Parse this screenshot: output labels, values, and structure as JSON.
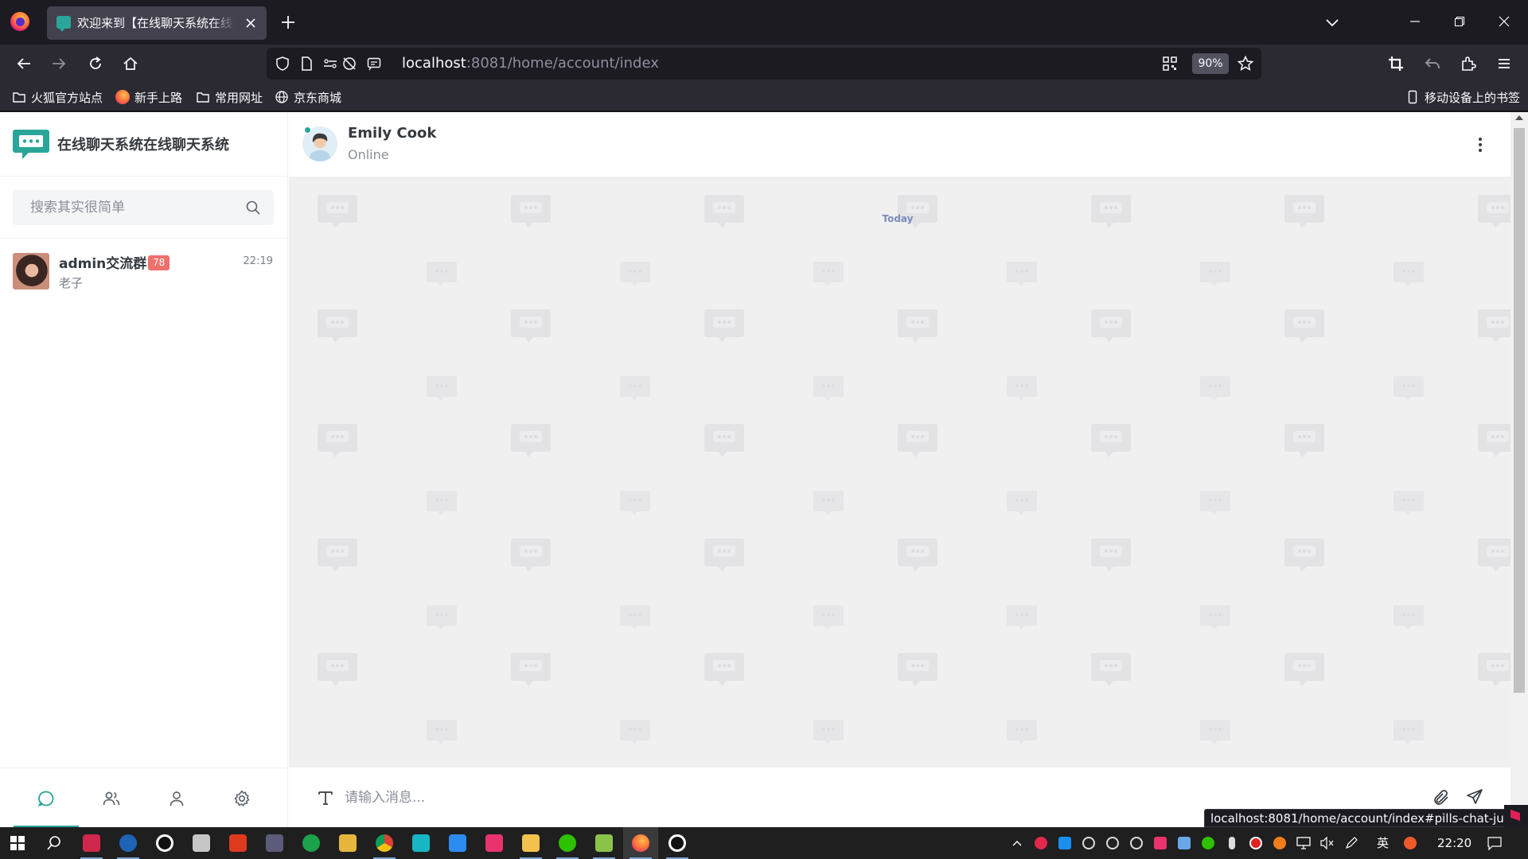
{
  "browser": {
    "tab_title": "欢迎来到【在线聊天系统在线聊天系统】",
    "url_host": "localhost",
    "url_rest": ":8081/home/account/index",
    "zoom": "90%",
    "status_url": "localhost:8081/home/account/index#pills-chat-just",
    "bookmarks": [
      {
        "label": "火狐官方站点",
        "icon": "folder-icon"
      },
      {
        "label": "新手上路",
        "icon": "firefox-icon"
      },
      {
        "label": "常用网址",
        "icon": "folder-icon"
      },
      {
        "label": "京东商城",
        "icon": "globe-icon"
      }
    ],
    "mobile_bookmarks": "移动设备上的书签"
  },
  "app": {
    "brand_name": "在线聊天系统在线聊天系统",
    "search_placeholder": "搜索其实很简单",
    "chats": [
      {
        "name": "admin交流群",
        "badge": "78",
        "last_message": "老子",
        "time": "22:19"
      }
    ],
    "side_tabs": [
      {
        "name": "chats",
        "icon": "chat-bubble-icon",
        "active": true
      },
      {
        "name": "contacts",
        "icon": "users-icon",
        "active": false
      },
      {
        "name": "profile",
        "icon": "user-icon",
        "active": false
      },
      {
        "name": "settings",
        "icon": "gear-icon",
        "active": false
      }
    ],
    "header": {
      "contact_name": "Emily Cook",
      "status": "Online"
    },
    "day_separator": "Today",
    "composer_placeholder": "请输入消息..."
  },
  "taskbar": {
    "time": "22:20",
    "ime": "英"
  },
  "colors": {
    "accent": "#2aa59a",
    "badge": "#ef6f6c",
    "browser_dark": "#1c1b22",
    "conversation_bg": "#f0f0f1"
  }
}
